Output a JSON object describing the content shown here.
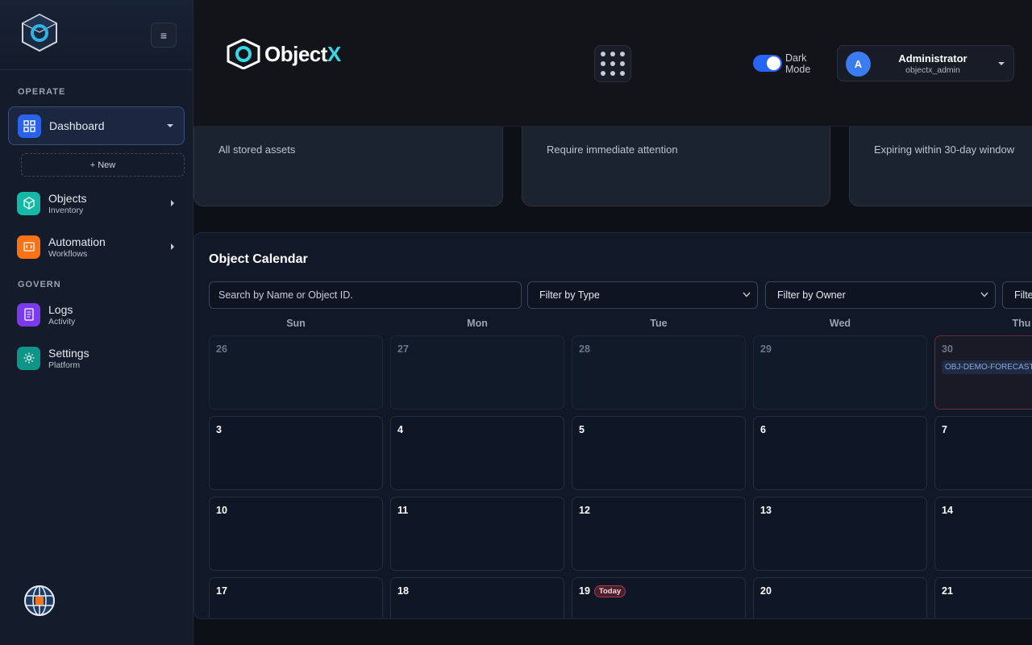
{
  "sidebar": {
    "menu_glyph": "≡",
    "sections": {
      "operate": "OPERATE",
      "govern": "GOVERN"
    },
    "new_button": "+ New",
    "items": [
      {
        "label": "Dashboard",
        "sub": "",
        "icon": "dashboard-icon",
        "color": "#2b62ea"
      },
      {
        "label": "Objects",
        "sub": "Inventory",
        "icon": "cube-icon",
        "color": "#14b8a6"
      },
      {
        "label": "Automation",
        "sub": "Workflows",
        "icon": "code-icon",
        "color": "#f97316"
      },
      {
        "label": "Logs",
        "sub": "Activity",
        "icon": "document-icon",
        "color": "#7c3aed"
      },
      {
        "label": "Settings",
        "sub": "Platform",
        "icon": "gear-icon",
        "color": "#0f9488"
      }
    ]
  },
  "header": {
    "brand_main": "Object",
    "brand_accent": "X",
    "dark_mode_label": "Dark Mode",
    "dark_mode_on": true,
    "user": {
      "initial": "A",
      "name": "Administrator",
      "handle": "objectx_admin"
    }
  },
  "stats": [
    {
      "text": "All stored assets"
    },
    {
      "text": "Require immediate attention"
    },
    {
      "text": "Expiring within 30-day window"
    }
  ],
  "calendar": {
    "title": "Object Calendar",
    "search_placeholder": "Search by Name or Object ID.",
    "filters": [
      "Filter by Type",
      "Filter by Owner",
      "Filter"
    ],
    "weekdays": [
      "Sun",
      "Mon",
      "Tue",
      "Wed",
      "Thu"
    ],
    "weeks": [
      [
        "26",
        "27",
        "28",
        "29",
        "30"
      ],
      [
        "3",
        "4",
        "5",
        "6",
        "7"
      ],
      [
        "10",
        "11",
        "12",
        "13",
        "14"
      ],
      [
        "17",
        "18",
        "19",
        "20",
        "21"
      ]
    ],
    "event_label": "OBJ-DEMO-FORECAST",
    "today_label": "Today"
  },
  "colors": {
    "accent": "#2764f5",
    "brand_accent": "#36d7e6"
  }
}
